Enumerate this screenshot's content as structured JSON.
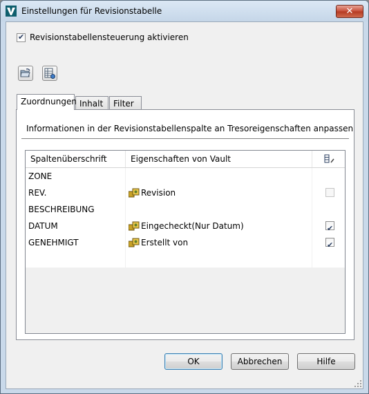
{
  "window": {
    "title": "Einstellungen für Revisionstabelle",
    "close_glyph": "✕"
  },
  "enable_checkbox": {
    "label": "Revisionstabellensteuerung aktivieren",
    "checked": true
  },
  "toolbar": {
    "icons": [
      "open-folder-icon",
      "table-settings-icon"
    ]
  },
  "tabs": [
    {
      "label": "Zuordnungen",
      "active": true
    },
    {
      "label": "Inhalt",
      "active": false
    },
    {
      "label": "Filter",
      "active": false
    }
  ],
  "panel": {
    "hint": "Informationen in der Revisionstabellenspalte an Tresoreigenschaften anpassen"
  },
  "grid": {
    "columns": [
      "Spaltenüberschrift",
      "Eigenschaften von Vault",
      "edit-column-icon"
    ],
    "rows": [
      {
        "heading": "ZONE",
        "property": "",
        "has_icon": false,
        "checkbox": "none"
      },
      {
        "heading": "REV.",
        "property": "Revision",
        "has_icon": true,
        "checkbox": "disabled"
      },
      {
        "heading": "BESCHREIBUNG",
        "property": "",
        "has_icon": false,
        "checkbox": "none"
      },
      {
        "heading": "DATUM",
        "property": "Eingecheckt(Nur Datum)",
        "has_icon": true,
        "checkbox": "checked"
      },
      {
        "heading": "GENEHMIGT",
        "property": "Erstellt von",
        "has_icon": true,
        "checkbox": "checked"
      },
      {
        "heading": "",
        "property": "",
        "has_icon": false,
        "checkbox": "none"
      }
    ]
  },
  "buttons": {
    "ok": "OK",
    "cancel": "Abbrechen",
    "help": "Hilfe"
  },
  "colors": {
    "titlebar": "#c9d9ea",
    "close": "#c7503b",
    "default_border": "#3c7fb1"
  }
}
